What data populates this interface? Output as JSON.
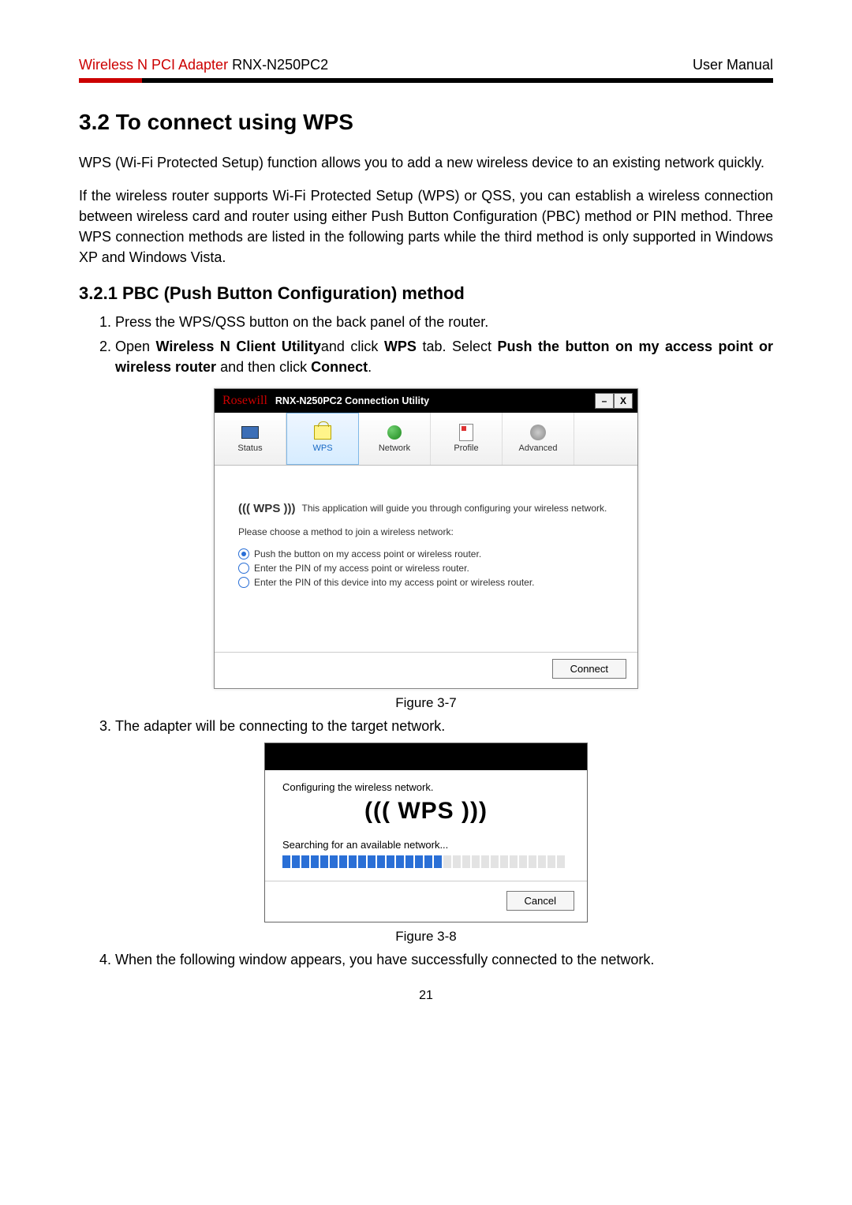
{
  "header": {
    "product_red": "Wireless N PCI Adapter",
    "product_model": " RNX-N250PC2",
    "right": "User Manual"
  },
  "section_title": "3.2  To connect using WPS",
  "para1": "WPS (Wi-Fi Protected Setup) function allows you to add a new wireless device to an existing network quickly.",
  "para2": "If the wireless router supports Wi-Fi Protected Setup (WPS) or QSS, you can establish a wireless connection between wireless card and router using either Push Button Configuration (PBC) method or PIN method. Three WPS connection methods are listed in the following parts while the third method is only supported in Windows XP and Windows Vista.",
  "subsection_title": "3.2.1 PBC (Push Button Configuration) method",
  "step1": "Press the WPS/QSS button on the back panel of the router.",
  "step2_a": "Open ",
  "step2_b": "Wireless N Client Utility",
  "step2_c": "and click ",
  "step2_d": "WPS",
  "step2_e": " tab. Select ",
  "step2_f": "Push the button on my access point or wireless router",
  "step2_g": " and then click ",
  "step2_h": "Connect",
  "step2_i": ".",
  "app1": {
    "logo": "Rosewill",
    "title": "RNX-N250PC2 Connection Utility",
    "tabs": {
      "status": "Status",
      "wps": "WPS",
      "network": "Network",
      "profile": "Profile",
      "advanced": "Advanced"
    },
    "wps_label": "((( WPS )))",
    "guide": "This application will guide you through configuring your wireless network.",
    "choose": "Please choose a method to join a wireless network:",
    "opt1": "Push the button on my access point or wireless router.",
    "opt2": "Enter the PIN of my access point or wireless router.",
    "opt3": "Enter the PIN of this device into my access point or wireless router.",
    "connect": "Connect"
  },
  "fig1": "Figure 3-7",
  "step3": "The adapter will be connecting to the target network.",
  "app2": {
    "cfg": "Configuring the wireless network.",
    "wps_big": "((( WPS )))",
    "search": "Searching for an available network...",
    "cancel": "Cancel",
    "progress_filled": 17,
    "progress_total": 30
  },
  "fig2": "Figure 3-8",
  "step4": "When the following window appears, you have successfully connected to the network.",
  "page_number": "21"
}
